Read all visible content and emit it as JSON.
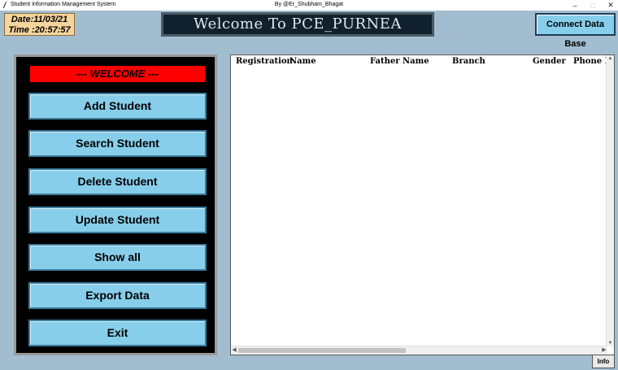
{
  "window": {
    "app_title": "Student Information Management System",
    "center_title": "By @Er_Shubham_Bhagat",
    "minimize": "–",
    "maximize": "□",
    "close": "✕"
  },
  "header": {
    "date": "Date:11/03/21",
    "time": "Time :20:57:57",
    "banner": "Welcome To PCE_PURNEA",
    "connect_label": "Connect Data Base"
  },
  "menu": {
    "welcome": "--- WELCOME ---",
    "items": [
      {
        "label": "Add Student"
      },
      {
        "label": "Search Student"
      },
      {
        "label": "Delete Student"
      },
      {
        "label": "Update Student"
      },
      {
        "label": "Show all"
      },
      {
        "label": "Export Data"
      },
      {
        "label": "Exit"
      }
    ]
  },
  "table": {
    "columns": [
      "Registration",
      "Name",
      "Father Name",
      "Branch",
      "Gender",
      "Phone No"
    ],
    "rows": []
  },
  "footer": {
    "info_label": "Info"
  },
  "colors": {
    "background": "#a2bdd0",
    "button": "#87ceeb",
    "welcome_bar": "#ff0000",
    "datetime_bg": "#f5d59c",
    "banner_bg": "#10202c"
  }
}
